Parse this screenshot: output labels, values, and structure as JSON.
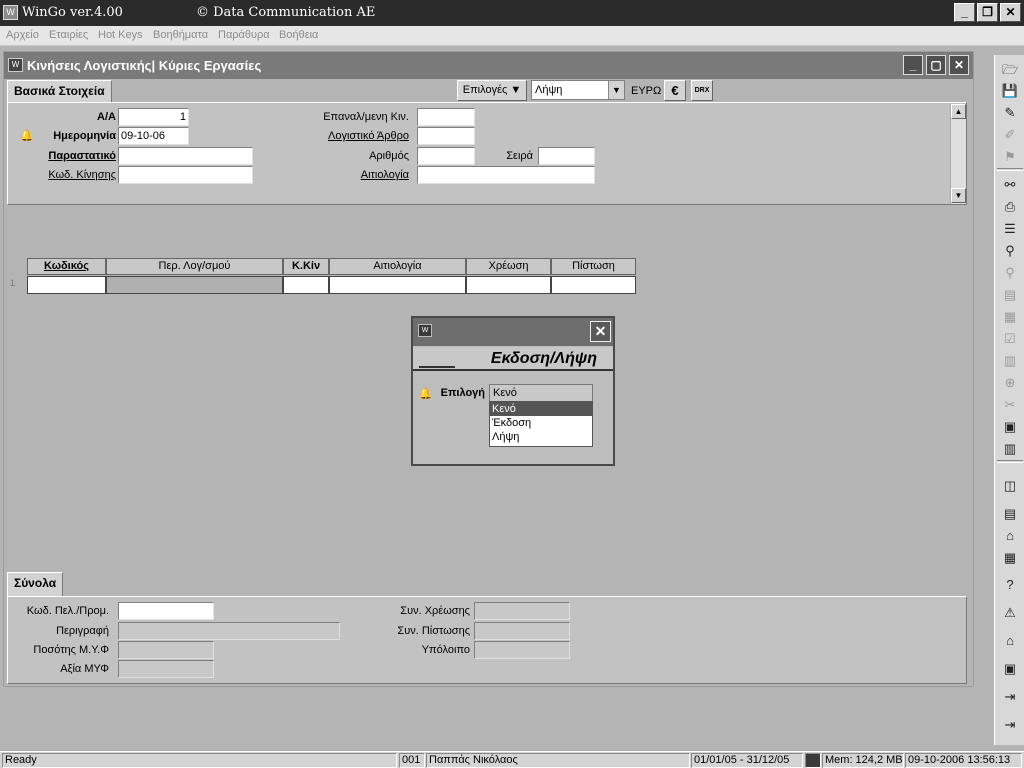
{
  "app": {
    "title": "WinGo ver.4.00",
    "company": "© Data Communication AE",
    "icon_label": "W"
  },
  "menu": [
    "Αρχείο",
    "Εταιρίες",
    "Hot Keys",
    "Βοηθήματα",
    "Παράθυρα",
    "Βοήθεια"
  ],
  "window_controls": {
    "minimize": "_",
    "restore": "❐",
    "close": "✕"
  },
  "child": {
    "title": "Κινήσεις Λογιστικής| Κύριες Εργασίες",
    "icon_label": "W"
  },
  "toolbar": {
    "options_label": "Επιλογές ▼",
    "type_select": "Λήψη",
    "currency_label": "ΕΥΡΩ",
    "euro_icon": "€",
    "drx_label": "DRX"
  },
  "basic": {
    "tab": "Βασικά Στοιχεία",
    "aa_label": "Α/Α",
    "aa_value": "1",
    "date_label": "Ημερομηνία",
    "date_value": "09-10-06",
    "doc_label": "Παραστατικό",
    "doc_value": "",
    "movecode_label": "Κωδ. Κίνησης",
    "movecode_value": "",
    "repeat_label": "Επαναλ/μενη Κιν.",
    "repeat_value": "",
    "article_label": "Λογιστικό Άρθρο",
    "article_value": "",
    "number_label": "Αριθμός",
    "number_value": "",
    "series_label": "Σειρά",
    "series_value": "",
    "reason_label": "Αιτιολογία",
    "reason_value": ""
  },
  "grid": {
    "headers": [
      "Κωδικός",
      "Περ. Λογ/σμού",
      "Κ.Κίν",
      "Αιτιολογία",
      "Χρέωση",
      "Πίστωση"
    ],
    "row_number": "1"
  },
  "dialog": {
    "icon_label": "W",
    "close": "✕",
    "heading": "Εκδοση/Λήψη",
    "field_label": "Επιλογή",
    "selected": "Κενό",
    "options": [
      "Κενό",
      "Έκδοση",
      "Λήψη"
    ]
  },
  "totals": {
    "tab": "Σύνολα",
    "client_code_label": "Κωδ. Πελ./Προμ.",
    "client_code_value": "",
    "description_label": "Περιγραφή",
    "description_value": "",
    "myf_amount_label": "Ποσότης Μ.Υ.Φ",
    "myf_amount_value": "",
    "myf_value_label": "Αξία ΜΥΦ",
    "myf_value_value": "",
    "sum_debit_label": "Συν. Χρέωσης",
    "sum_debit_value": "",
    "sum_credit_label": "Συν. Πίστωσης",
    "sum_credit_value": "",
    "balance_label": "Υπόλοιπο",
    "balance_value": ""
  },
  "status": {
    "ready": "Ready",
    "code": "001",
    "user": "Παππάς Νικόλαος",
    "period": "01/01/05 - 31/12/05",
    "memory": "Mem: 124,2 MB",
    "datetime": "09-10-2006 13:56:13"
  },
  "right_toolbar_icons": [
    "open-folder-icon",
    "save-icon",
    "eraser-icon",
    "brush-icon",
    "flag-icon",
    "binoculars-icon",
    "printer-icon",
    "stack-icon",
    "search-icon",
    "pin-icon",
    "document-icon",
    "edit-icon",
    "checklist-icon",
    "chart-icon",
    "zoom-icon",
    "tools-icon",
    "report-icon",
    "barcode-icon",
    "columns-icon",
    "ledger-icon",
    "bank-icon",
    "calculator-icon",
    "help-icon",
    "warning-icon",
    "building-icon",
    "preview-icon",
    "exit-icon",
    "logout-icon"
  ]
}
